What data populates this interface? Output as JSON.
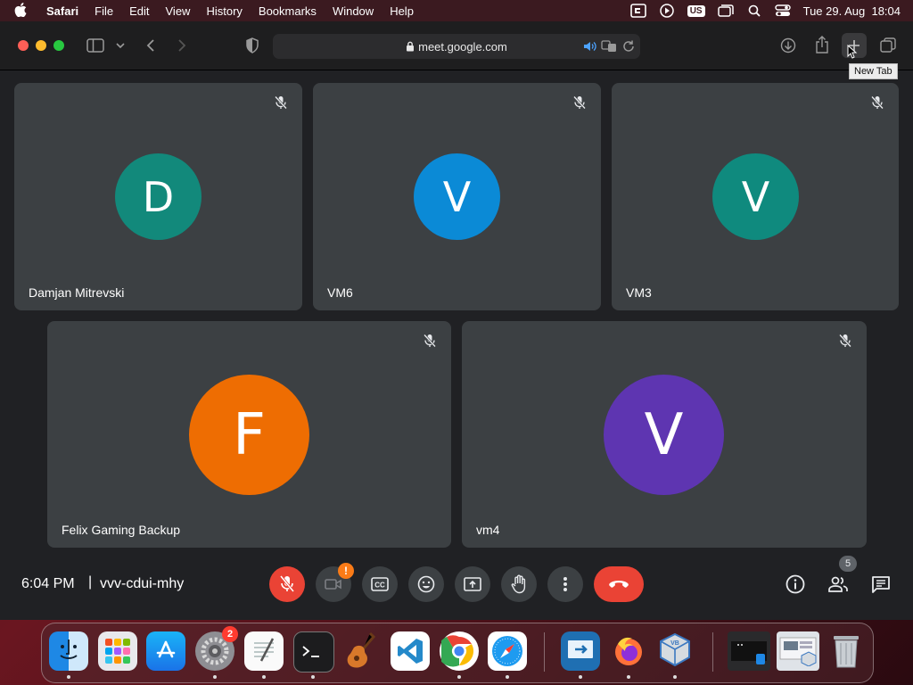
{
  "menubar": {
    "app_name": "Safari",
    "items": [
      "File",
      "Edit",
      "View",
      "History",
      "Bookmarks",
      "Window",
      "Help"
    ],
    "keyboard_layout": "US",
    "datetime": "Tue 29. Aug  18:04"
  },
  "browser": {
    "url": "meet.google.com",
    "tooltip": "New Tab"
  },
  "meet": {
    "participants": [
      {
        "name": "Damjan Mitrevski",
        "initial": "D",
        "color": "#12897b",
        "muted": true
      },
      {
        "name": "VM6",
        "initial": "V",
        "color": "#0b8ad6",
        "muted": true
      },
      {
        "name": "VM3",
        "initial": "V",
        "color": "#0f8a7e",
        "muted": true
      },
      {
        "name": "Felix Gaming Backup",
        "initial": "F",
        "color": "#ee6d02",
        "muted": true
      },
      {
        "name": "vm4",
        "initial": "V",
        "color": "#5e35b1",
        "muted": true
      }
    ],
    "time": "6:04 PM",
    "separator": "|",
    "meeting_code": "vvv-cdui-mhy",
    "camera_alert": "!",
    "participant_count": "5"
  },
  "dock": {
    "settings_badge": "2",
    "apps": [
      "finder-icon",
      "launchpad-icon",
      "app-store-icon",
      "system-settings-icon",
      "textedit-icon",
      "terminal-icon",
      "garageband-icon",
      "vscode-icon",
      "chrome-icon",
      "safari-icon",
      "remote-desktop-icon",
      "firefox-icon",
      "virtualbox-icon",
      "screenshot-window-icon",
      "preview-window-icon",
      "trash-icon"
    ]
  }
}
